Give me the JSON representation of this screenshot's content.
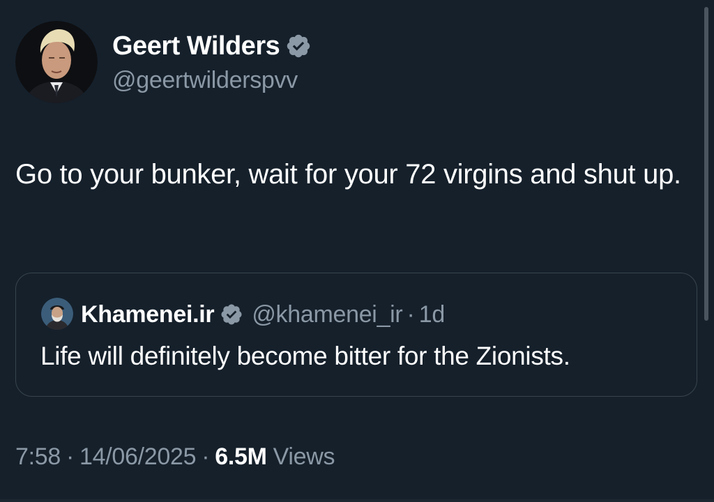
{
  "author": {
    "display_name": "Geert Wilders",
    "handle": "@geertwilderspvv",
    "avatar_icon": "portrait-avatar",
    "verified": true
  },
  "tweet": {
    "text": "Go to your bunker, wait for your 72 virgins and shut up."
  },
  "quote": {
    "display_name": "Khamenei.ir",
    "handle": "@khamenei_ir",
    "separator": "·",
    "time": "1d",
    "text": "Life will definitely become bitter for the Zionists.",
    "verified": true
  },
  "meta": {
    "time": "7:58",
    "date": "14/06/2025",
    "separator": "·",
    "views_count": "6.5M",
    "views_label": "Views"
  },
  "colors": {
    "background": "#15202b",
    "text_primary": "#ffffff",
    "text_secondary": "#8b98a5",
    "border": "#38444d",
    "verified_badge": "#8b98a5"
  }
}
